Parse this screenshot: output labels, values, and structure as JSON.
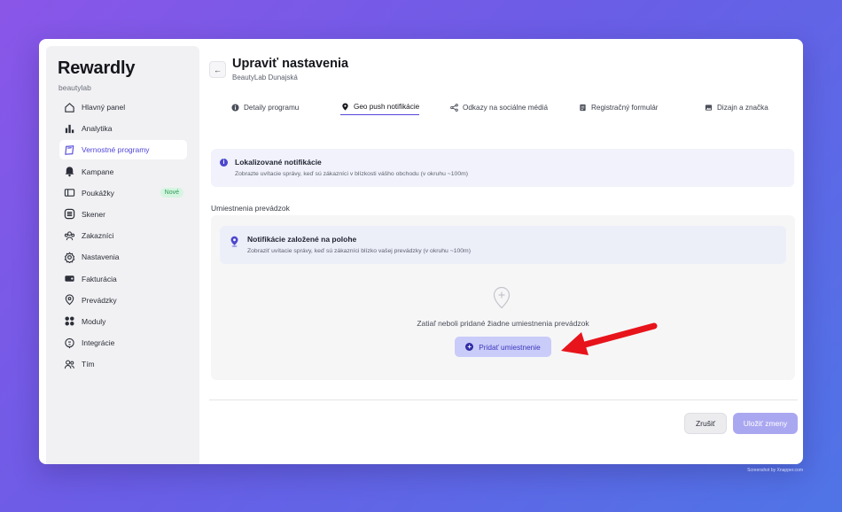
{
  "app": {
    "logo": "Rewardly",
    "workspace": "beautylab"
  },
  "sidebar": {
    "items": [
      {
        "label": "Hlavný panel",
        "icon": "home-icon"
      },
      {
        "label": "Analytika",
        "icon": "bar-chart-icon"
      },
      {
        "label": "Vernostné programy",
        "icon": "loyalty-card-icon",
        "active": true
      },
      {
        "label": "Kampane",
        "icon": "bell-icon"
      },
      {
        "label": "Poukážky",
        "icon": "voucher-icon",
        "badge": "Nové"
      },
      {
        "label": "Skener",
        "icon": "scanner-icon"
      },
      {
        "label": "Zakazníci",
        "icon": "customers-icon"
      },
      {
        "label": "Nastavenia",
        "icon": "gear-icon"
      },
      {
        "label": "Fakturácia",
        "icon": "wallet-icon"
      },
      {
        "label": "Prevádzky",
        "icon": "location-pin-icon"
      },
      {
        "label": "Moduly",
        "icon": "modules-grid-icon"
      },
      {
        "label": "Integrácie",
        "icon": "integration-icon"
      },
      {
        "label": "Tím",
        "icon": "team-icon"
      }
    ]
  },
  "header": {
    "back_icon": "←",
    "title": "Upraviť nastavenia",
    "subtitle": "BeautyLab Dunajská"
  },
  "tabs": [
    {
      "label": "Detaily programu",
      "icon": "info-icon"
    },
    {
      "label": "Geo push notifikácie",
      "icon": "location-pin-icon",
      "active": true
    },
    {
      "label": "Odkazy na sociálne médiá",
      "icon": "share-icon"
    },
    {
      "label": "Registračný formulár",
      "icon": "form-icon"
    },
    {
      "label": "Dizajn a značka",
      "icon": "image-icon"
    }
  ],
  "info": {
    "icon_glyph": "i",
    "title": "Lokalizované notifikácie",
    "description": "Zobrazte uvítacie správy, keď sú zákazníci v blízkosti vášho obchodu (v okruhu ~100m)"
  },
  "locations": {
    "section_label": "Umiestnenia prevádzok",
    "card_title": "Notifikácie založené na polohe",
    "card_description": "Zobraziť uvítacie správy, keď sú zákazníci blízko vašej prevádzky (v okruhu ~100m)",
    "empty_text": "Zatiaľ neboli pridané žiadne umiestnenia prevádzok",
    "add_glyph": "+",
    "add_button": "Pridať umiestnenie"
  },
  "footer": {
    "cancel": "Zrušiť",
    "save": "Uložiť zmeny"
  },
  "watermark": "Screenshot by Xnapper.com",
  "colors": {
    "accent": "#5146d8",
    "arrow": "#e8141b",
    "badge_bg": "#d5f5e0",
    "badge_text": "#2b9a55"
  }
}
